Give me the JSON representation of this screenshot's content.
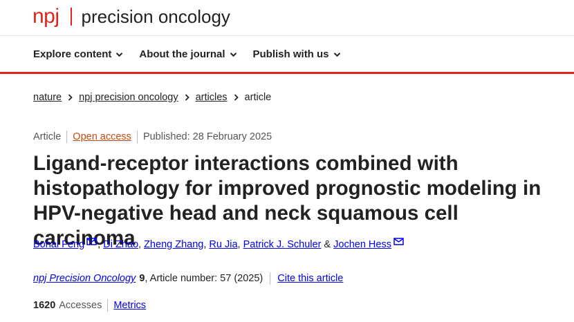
{
  "site": {
    "brand": "npj",
    "journal_name": "precision oncology"
  },
  "nav": {
    "items": [
      {
        "label": "Explore content"
      },
      {
        "label": "About the journal"
      },
      {
        "label": "Publish with us"
      }
    ]
  },
  "breadcrumb": {
    "items": [
      "nature",
      "npj precision oncology",
      "articles"
    ],
    "current": "article"
  },
  "article": {
    "type": "Article",
    "access": "Open access",
    "published": "Published: 28 February 2025",
    "title": "Ligand-receptor interactions combined with histopathology for improved prognostic modeling in HPV-negative head and neck squamous cell carcinoma",
    "authors": [
      "Bohai Feng",
      "Di Zhao",
      "Zheng Zhang",
      "Ru Jia",
      "Patrick J. Schuler",
      "Jochen Hess"
    ],
    "author_separator": ", ",
    "author_last_join": " & ",
    "citation": {
      "journal": "npj Precision Oncology",
      "volume": "9",
      "article_number": ", Article number: 57 (2025)",
      "cite_label": "Cite this article"
    },
    "metrics": {
      "accesses_count": "1620",
      "accesses_label": "Accesses",
      "metrics_label": "Metrics"
    }
  },
  "colors": {
    "brand_red": "#e0251b",
    "link_blue": "#0000ee",
    "open_access_orange": "#c44a10"
  }
}
